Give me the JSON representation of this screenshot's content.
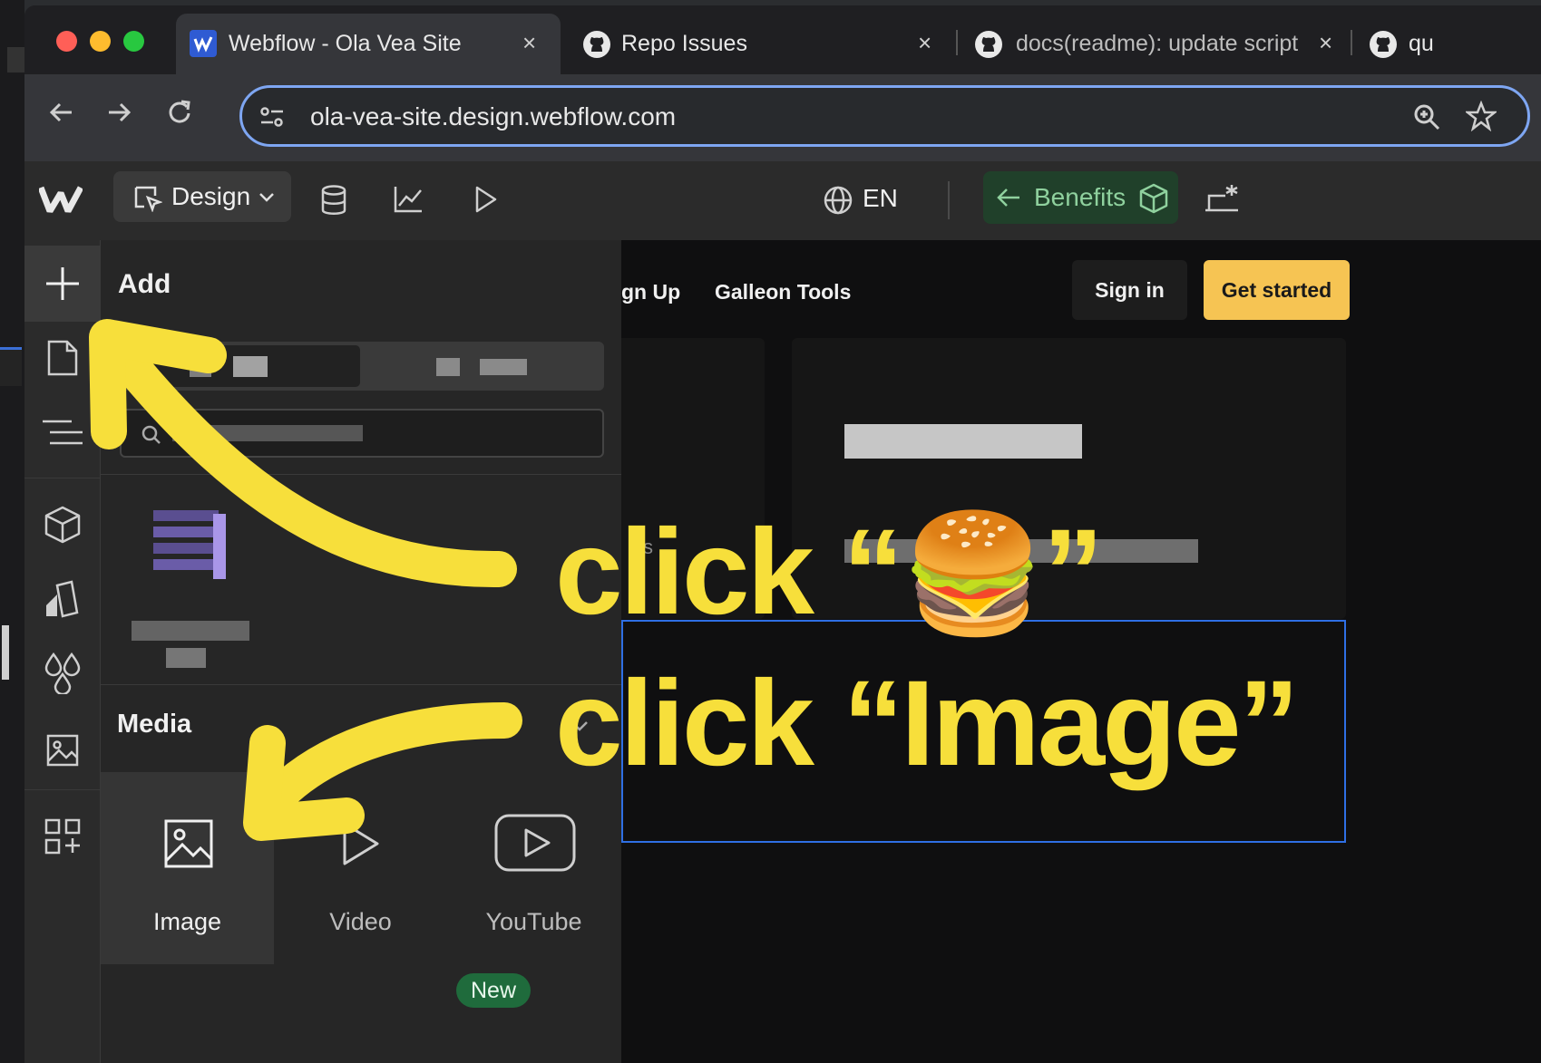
{
  "browser": {
    "tabs": [
      {
        "label": "Webflow - Ola Vea Site",
        "active": true
      },
      {
        "label": "Repo Issues",
        "active": false
      },
      {
        "label": "docs(readme): update script",
        "active": false
      },
      {
        "label": "qu",
        "active": false
      }
    ],
    "close_glyph": "×",
    "url": "ola-vea-site.design.webflow.com",
    "colors": {
      "close": "#ff5f57",
      "minimize": "#febc2e",
      "zoom": "#28c840",
      "focus_ring": "#7ea6f2"
    }
  },
  "designer": {
    "mode_label": "Design",
    "locale": "EN",
    "page_button_label": "Benefits",
    "add_panel": {
      "title": "Add",
      "media_title": "Media",
      "media_items": [
        {
          "label": "Image",
          "icon": "image-icon"
        },
        {
          "label": "Video",
          "icon": "play-icon"
        },
        {
          "label": "YouTube",
          "icon": "youtube-icon"
        }
      ],
      "new_badge": "New"
    },
    "canvas": {
      "nav_links": [
        "gn Up",
        "Galleon Tools"
      ],
      "signin_label": "Sign in",
      "get_started_label": "Get started",
      "card_fragment": "s"
    }
  },
  "annotations": {
    "callout_1_prefix": "click “",
    "callout_1_emoji": "🍔",
    "callout_1_suffix": "”",
    "callout_2": "click “Image”",
    "color": "#f7df3b"
  },
  "theme": {
    "accent_yellow": "#f6c453",
    "benefits_green": "#8fd19e",
    "canvas_selection": "#2f6fe4"
  }
}
